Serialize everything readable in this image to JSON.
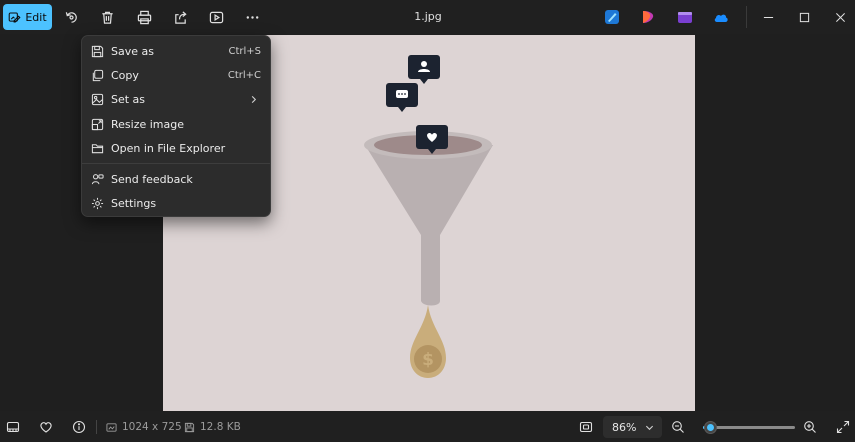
{
  "toolbar": {
    "edit_label": "Edit",
    "file_name": "1.jpg"
  },
  "menu": {
    "items": [
      {
        "label": "Save as",
        "shortcut": "Ctrl+S",
        "icon": "save-icon"
      },
      {
        "label": "Copy",
        "shortcut": "Ctrl+C",
        "icon": "copy-icon"
      },
      {
        "label": "Set as",
        "shortcut": "",
        "icon": "set-as-icon",
        "submenu": true
      },
      {
        "label": "Resize image",
        "shortcut": "",
        "icon": "resize-icon"
      },
      {
        "label": "Open in File Explorer",
        "shortcut": "",
        "icon": "folder-icon"
      },
      {
        "label": "Send feedback",
        "shortcut": "",
        "icon": "feedback-icon"
      },
      {
        "label": "Settings",
        "shortcut": "",
        "icon": "gear-icon"
      }
    ]
  },
  "status": {
    "dimensions": "1024 x 725",
    "file_size": "12.8 KB",
    "zoom": "86%",
    "zoom_slider_fraction": 0.08
  },
  "colors": {
    "accent": "#4cc2ff",
    "canvas_bg": "#ddd4d4",
    "menu_bg": "#2c2c2c"
  }
}
